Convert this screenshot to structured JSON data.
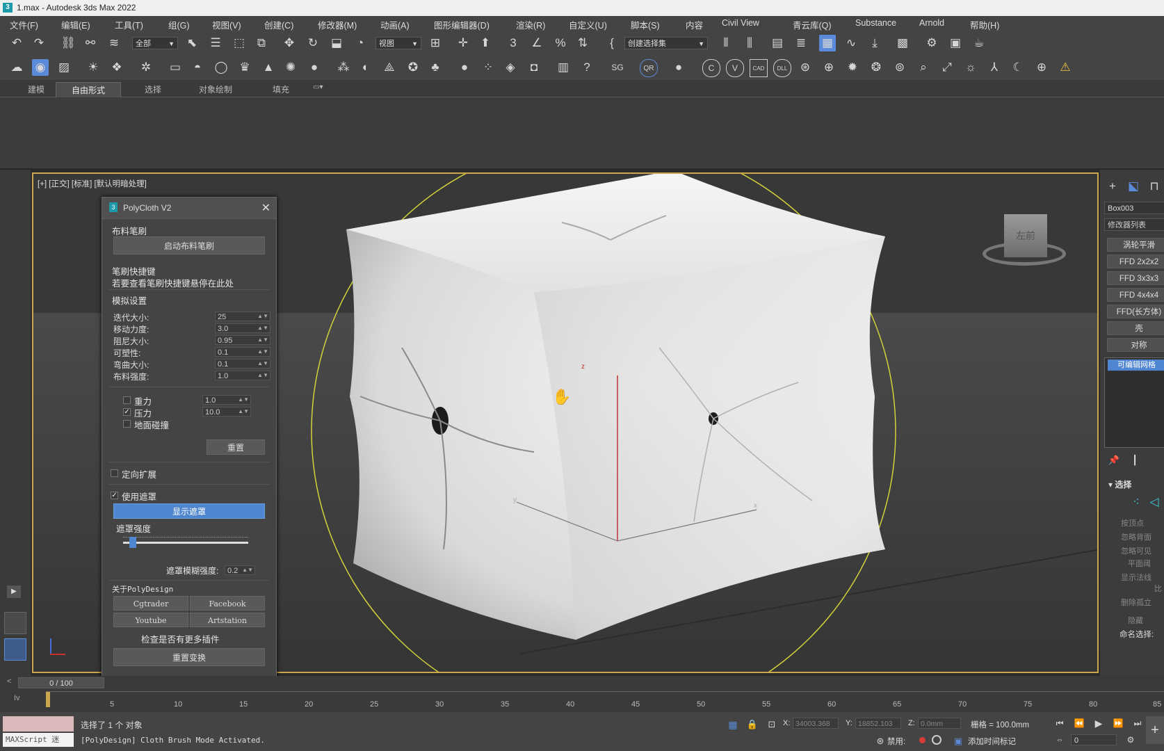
{
  "title": "1.max - Autodesk 3ds Max 2022",
  "menu": [
    "文件(F)",
    "编辑(E)",
    "工具(T)",
    "组(G)",
    "视图(V)",
    "创建(C)",
    "修改器(M)",
    "动画(A)",
    "图形编辑器(D)",
    "渲染(R)",
    "自定义(U)",
    "脚本(S)",
    "内容",
    "Civil View",
    "青云库(Q)",
    "Substance",
    "Arnold",
    "帮助(H)"
  ],
  "toolbar": {
    "filter_value": "全部",
    "refcoord_value": "视图",
    "selset_value": "创建选择集",
    "btn_qr": "QR",
    "btn_sg": "SG",
    "btn_c": "C",
    "btn_v": "V",
    "btn_cad": "CAD",
    "btn_dll": "DLL"
  },
  "ribbon_tabs": [
    "建模",
    "自由形式",
    "选择",
    "对象绘制",
    "填充"
  ],
  "viewport": {
    "label": "[+] [正交] [标准] [默认明暗处理]",
    "axis_z": "z",
    "axis_x": "x",
    "axis_y": "y",
    "viewcube": "左前"
  },
  "dialog": {
    "title": "PolyCloth V2",
    "sec_brush": "布料笔刷",
    "btn_start": "启动布料笔刷",
    "sec_shortcut": "笔刷快捷键",
    "shortcut_hint": "若要查看笔刷快捷键悬停在此处",
    "sec_sim": "模拟设置",
    "params": [
      {
        "label": "迭代大小:",
        "value": "25"
      },
      {
        "label": "移动力度:",
        "value": "3.0"
      },
      {
        "label": "阻尼大小:",
        "value": "0.95"
      },
      {
        "label": "可塑性:",
        "value": "0.1"
      },
      {
        "label": "弯曲大小:",
        "value": "0.1"
      },
      {
        "label": "布料强度:",
        "value": "1.0"
      }
    ],
    "gravity_label": "重力",
    "gravity_value": "1.0",
    "pressure_label": "压力",
    "pressure_value": "10.0",
    "ground_label": "地面碰撞",
    "btn_reset": "重置",
    "directional_label": "定向扩展",
    "use_mask_label": "使用遮罩",
    "btn_show_mask": "显示遮罩",
    "mask_strength_label": "遮罩强度",
    "mask_strength_value": 0.02,
    "mask_blur_label": "遮罩模糊强度:",
    "mask_blur_value": "0.2",
    "about_label": "关于PolyDesign",
    "link_cgtrader": "Cgtrader",
    "link_facebook": "Facebook",
    "link_youtube": "Youtube",
    "link_artstation": "Artstation",
    "check_more": "检查是否有更多插件",
    "btn_reset_transform": "重置变换"
  },
  "right_panel": {
    "object_name": "Box003",
    "modifier_list": "修改器列表",
    "buttons": [
      "涡轮平滑",
      "FFD 2x2x2",
      "FFD 3x3x3",
      "FFD 4x4x4",
      "FFD(长方体)",
      "壳",
      "对称"
    ],
    "stack_item": "可编辑网格",
    "section_select": "选择",
    "opt_byvertex": "按顶点",
    "opt_ignore_back": "忽略背面",
    "opt_ignore_visible": "忽略可见",
    "opt_planar": "平面阈",
    "opt_show_normals": "显示法线",
    "opt_scale": "比",
    "opt_delete_isolated": "删除孤立",
    "opt_hide": "隐藏",
    "named_sel": "命名选择:"
  },
  "timeline": {
    "frame_counter": "0 / 100",
    "ticks": [
      "5",
      "10",
      "15",
      "20",
      "25",
      "30",
      "35",
      "40",
      "45",
      "50",
      "55",
      "60",
      "65",
      "70",
      "75",
      "80",
      "85"
    ]
  },
  "status": {
    "maxscript": "MAXScript 迷",
    "selected": "选择了 1 个 对象",
    "message": "[PolyDesign] Cloth Brush Mode Activated.",
    "x_label": "X:",
    "x_value": "34003.368",
    "y_label": "Y:",
    "y_value": "18852.103",
    "z_label": "Z:",
    "z_value": "0.0mm",
    "grid": "栅格 = 100.0mm",
    "disable": "禁用:",
    "add_time_tag": "添加时间标记",
    "frame_value": "0"
  },
  "colors": {
    "accent_blue": "#4f86cf",
    "viewport_border": "#c9a74a",
    "trajectory": "#d4d23a"
  }
}
